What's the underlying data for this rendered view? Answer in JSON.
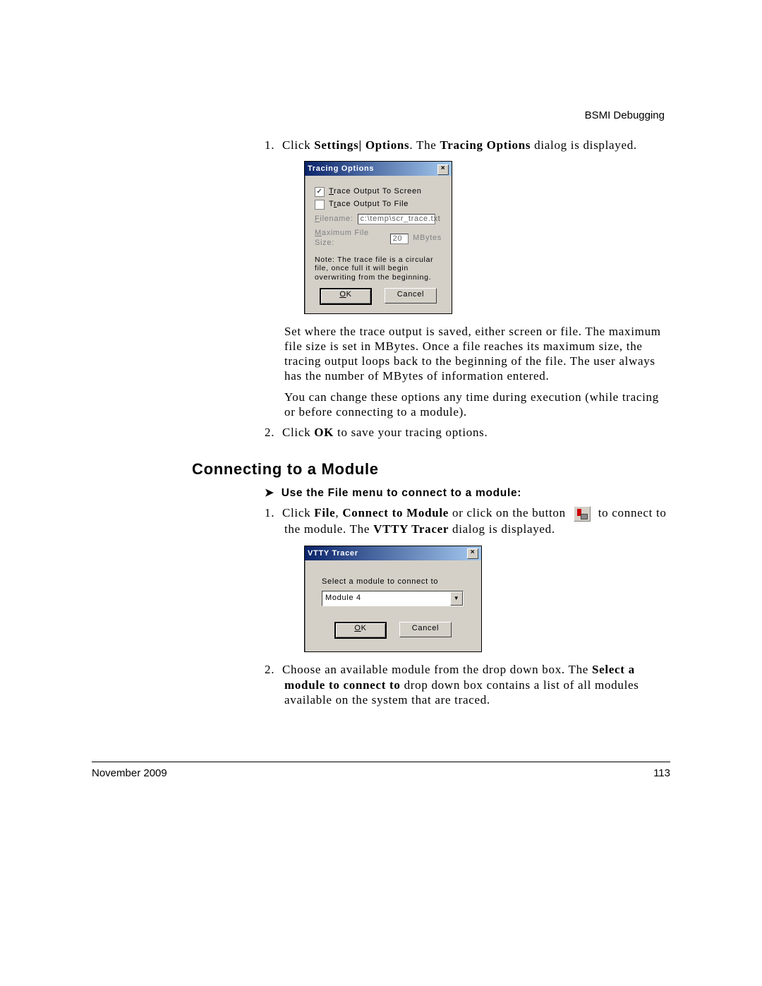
{
  "header": {
    "right": "BSMI Debugging"
  },
  "intro": {
    "step1_prefix": "Click ",
    "step1_bold": "Settings| Options",
    "step1_mid": ". The ",
    "step1_bold2": "Tracing Options",
    "step1_suffix": " dialog is displayed."
  },
  "dialog1": {
    "title": "Tracing Options",
    "opt_screen": "Trace Output To Screen",
    "opt_file": "Trace Output To File",
    "filename_label": "Filename:",
    "filename_value": "c:\\temp\\scr_trace.txt",
    "maxsize_label": "Maximum File Size:",
    "maxsize_value": "20",
    "maxsize_unit": "MBytes",
    "note": "Note: The trace file is a circular file, once full it will begin overwriting from the beginning.",
    "ok": "OK",
    "cancel": "Cancel"
  },
  "para_after_dlg1": "Set where the trace output is saved, either screen or file. The maximum file size is set in MBytes. Once a file reaches its maximum size, the tracing output loops back to the beginning of the file. The user always has the number of MBytes of information entered.",
  "para_change": "You can change these options any time during execution (while tracing or before connecting to a module).",
  "step2_prefix": "Click ",
  "step2_bold": "OK",
  "step2_suffix": " to save your tracing options.",
  "section2": {
    "heading": "Connecting to a Module",
    "sub": "Use the File menu to connect to a module:",
    "s1_a": "Click ",
    "s1_b": "File",
    "s1_c": ", ",
    "s1_d": "Connect to Module",
    "s1_e": " or click on the button ",
    "s1_f": " to connect to the module. The ",
    "s1_g": "VTTY Tracer",
    "s1_h": " dialog is displayed."
  },
  "dialog2": {
    "title": "VTTY Tracer",
    "label": "Select a module to connect to",
    "selected": "Module 4",
    "ok": "OK",
    "cancel": "Cancel"
  },
  "sec2_step2_a": "Choose an available module from the drop down box. The ",
  "sec2_step2_b": "Select a module to connect to",
  "sec2_step2_c": " drop down box contains a list of all modules available on the system that are traced.",
  "footer": {
    "left": "November 2009",
    "right": "113"
  }
}
